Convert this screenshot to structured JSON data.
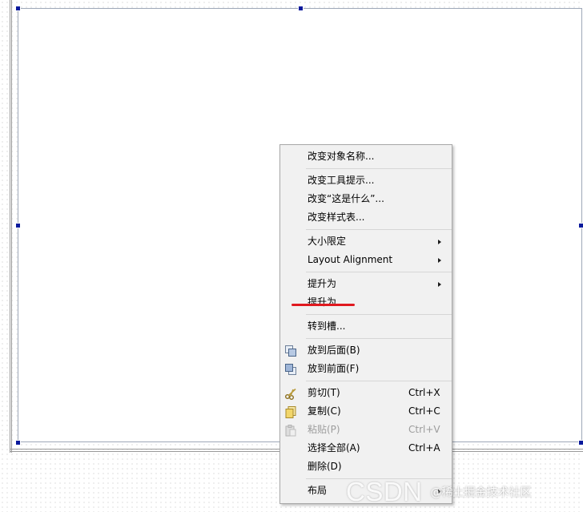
{
  "context_menu": {
    "groups": [
      [
        {
          "label": "改变对象名称..."
        }
      ],
      [
        {
          "label": "改变工具提示..."
        },
        {
          "label": "改变“这是什么”..."
        },
        {
          "label": "改变样式表..."
        }
      ],
      [
        {
          "label": "大小限定",
          "submenu": true
        },
        {
          "label": "Layout Alignment",
          "submenu": true
        }
      ],
      [
        {
          "label": "提升为",
          "submenu": true
        },
        {
          "label": "提升为..."
        }
      ],
      [
        {
          "label": "转到槽..."
        }
      ],
      [
        {
          "label": "放到后面(B)",
          "icon": "send-to-back-icon"
        },
        {
          "label": "放到前面(F)",
          "icon": "bring-to-front-icon"
        }
      ],
      [
        {
          "label": "剪切(T)",
          "shortcut": "Ctrl+X",
          "icon": "scissors-icon"
        },
        {
          "label": "复制(C)",
          "shortcut": "Ctrl+C",
          "icon": "copy-icon"
        },
        {
          "label": "粘贴(P)",
          "shortcut": "Ctrl+V",
          "icon": "paste-icon",
          "disabled": true
        },
        {
          "label": "选择全部(A)",
          "shortcut": "Ctrl+A"
        },
        {
          "label": "删除(D)"
        }
      ],
      [
        {
          "label": "布局",
          "submenu": true
        }
      ]
    ]
  },
  "watermark": {
    "logo": "CSDN",
    "handle": "@稀土掘金技术社区"
  },
  "colors": {
    "menu_background": "#f1f1f1",
    "selection_handle": "#0a1a9c",
    "annotation_underline": "#e0191f",
    "disabled_text": "#9c9c9c"
  }
}
